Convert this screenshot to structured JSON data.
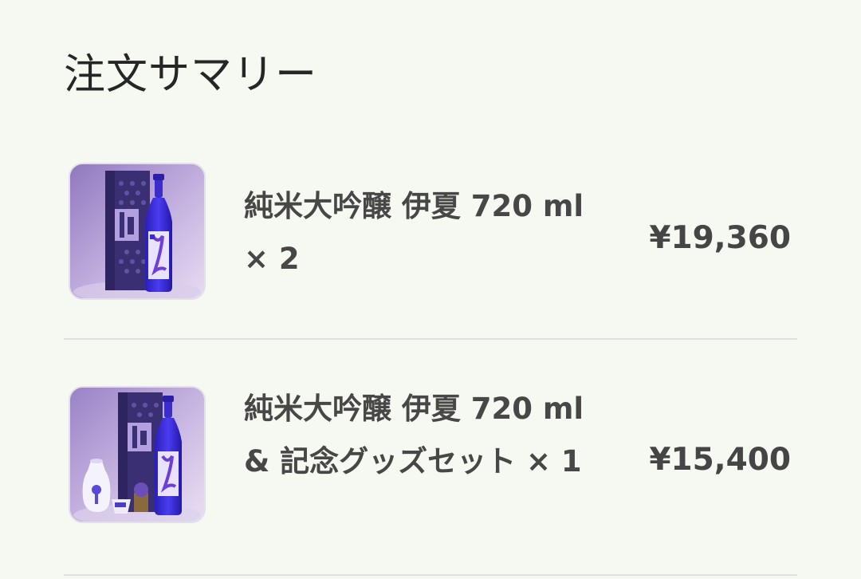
{
  "summary": {
    "title": "注文サマリー"
  },
  "items": [
    {
      "name": "純米大吟醸 伊夏 720 ml × 2",
      "price": "¥19,360",
      "image_icon": "sake-bottle-with-box-icon"
    },
    {
      "name": "純米大吟醸 伊夏 720 ml & 記念グッズセット × 1",
      "price": "¥15,400",
      "image_icon": "sake-set-with-goods-icon"
    }
  ],
  "colors": {
    "background": "#f6f9f1",
    "text": "#474747",
    "thumb_purple": "#9a7fc4",
    "bottle_blue": "#3d2fd6"
  }
}
